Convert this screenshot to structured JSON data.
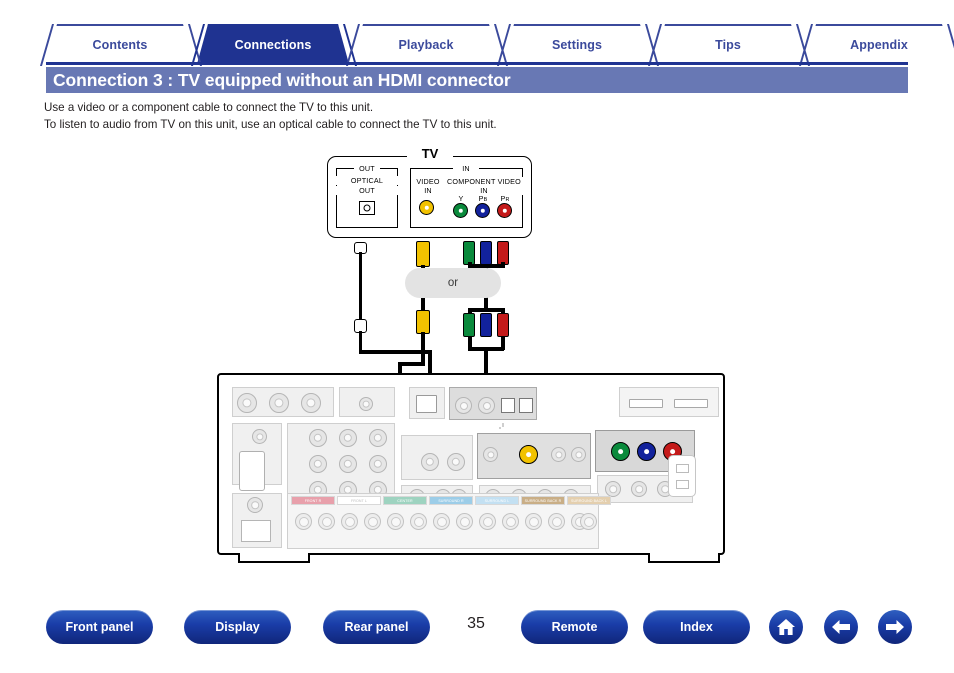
{
  "nav_tabs": [
    {
      "label": "Contents",
      "active": false
    },
    {
      "label": "Connections",
      "active": true
    },
    {
      "label": "Playback",
      "active": false
    },
    {
      "label": "Settings",
      "active": false
    },
    {
      "label": "Tips",
      "active": false
    },
    {
      "label": "Appendix",
      "active": false
    }
  ],
  "title": "Connection 3 : TV equipped without an HDMI connector",
  "body": {
    "line1": "Use a video or a component cable to connect the TV to this unit.",
    "line2": "To listen to audio from TV on this unit, use an optical cable to connect the TV to this unit."
  },
  "diagram": {
    "tv_label": "TV",
    "or_label": "or",
    "tv_panel": {
      "optical_group_caption": "OUT",
      "optical_label_1": "OPTICAL",
      "optical_label_2": "OUT",
      "in_group_caption": "IN",
      "video_in_1": "VIDEO",
      "video_in_2": "IN",
      "component_1": "COMPONENT VIDEO",
      "component_2": "IN",
      "component_jacks": [
        {
          "label": "Y",
          "sub": "",
          "color": "#0a8a3c"
        },
        {
          "label": "P",
          "sub": "B",
          "color": "#12229c"
        },
        {
          "label": "P",
          "sub": "R",
          "color": "#c41a1a"
        }
      ],
      "video_jack_color": "#f2c200"
    },
    "amp_panel": {
      "speaker_bands": [
        {
          "label": "FRONT R",
          "color": "#e8a0ab"
        },
        {
          "label": "FRONT L",
          "color": "#ffffff"
        },
        {
          "label": "CENTER",
          "color": "#9ed3c0"
        },
        {
          "label": "SURROUND R",
          "color": "#9ccde8"
        },
        {
          "label": "SURROUND L",
          "color": "#c3e0f2"
        },
        {
          "label": "SURROUND BACK R",
          "color": "#c9ae86"
        },
        {
          "label": "SURROUND BACK L",
          "color": "#e4cfae"
        }
      ],
      "component_in_jacks": [
        {
          "color": "#0a8a3c"
        },
        {
          "color": "#12229c"
        },
        {
          "color": "#c41a1a"
        }
      ],
      "video_out_jack_color": "#f2c200"
    }
  },
  "bottom_nav": {
    "buttons": [
      {
        "label": "Front panel"
      },
      {
        "label": "Display"
      },
      {
        "label": "Rear panel"
      },
      {
        "label": "Remote"
      },
      {
        "label": "Index"
      }
    ],
    "icons": [
      {
        "name": "home-icon"
      },
      {
        "name": "arrow-left-icon"
      },
      {
        "name": "arrow-right-icon"
      }
    ],
    "page_number": "35"
  },
  "colors": {
    "tab_active_bg": "#1f3391",
    "tab_text": "#3b4a9c",
    "title_bar_bg": "#6878b4",
    "button_blue": "#1a3da8"
  }
}
